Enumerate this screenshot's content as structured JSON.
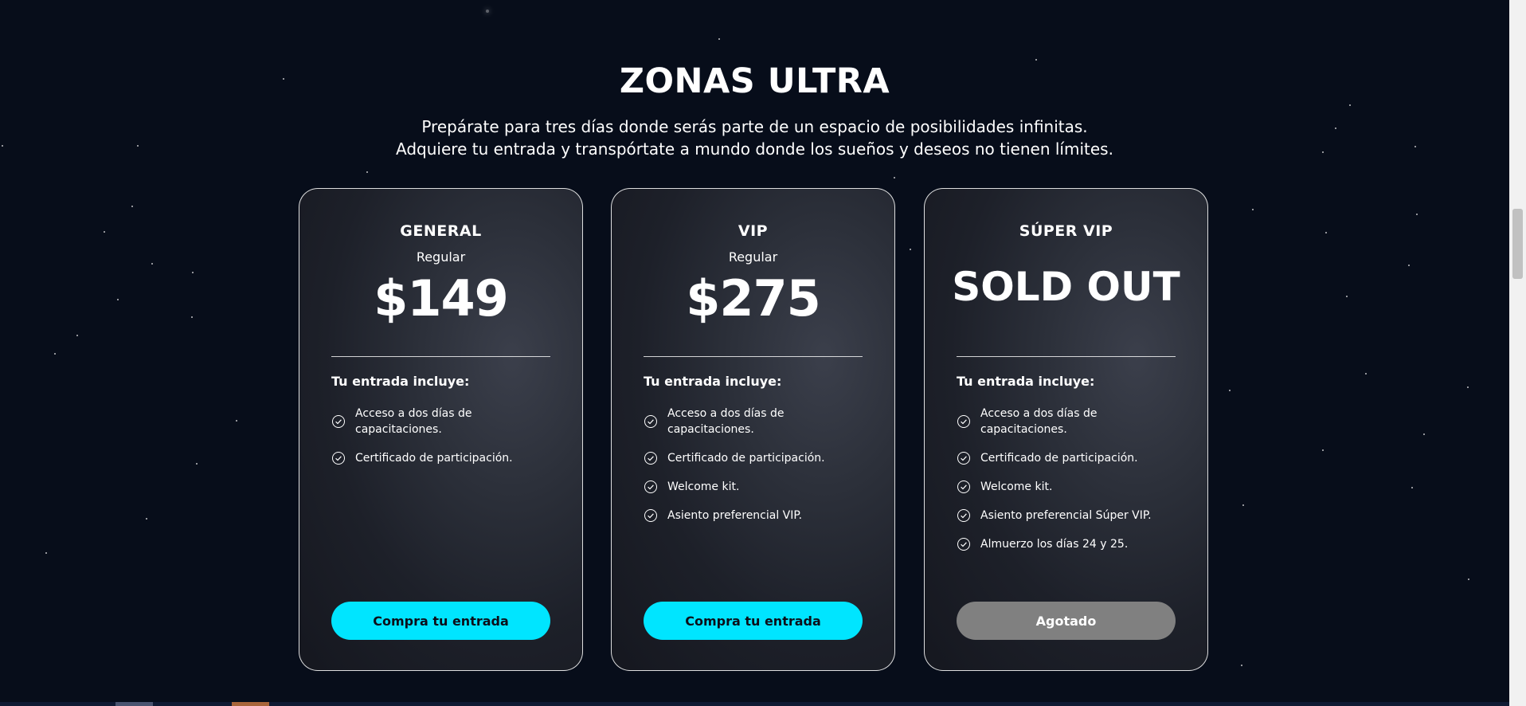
{
  "section": {
    "title": "ZONAS ULTRA",
    "subtitle_line1": "Prepárate para tres días donde serás parte de un espacio de posibilidades infinitas.",
    "subtitle_line2": "Adquiere tu entrada y transpórtate a mundo donde los sueños y deseos no tienen límites."
  },
  "colors": {
    "background": "#070d1a",
    "accent": "#00e5ff",
    "sold_out_button": "#808080"
  },
  "cards": [
    {
      "name": "GENERAL",
      "subtitle": "Regular",
      "price": "$149",
      "includes_label": "Tu entrada incluye:",
      "features": [
        "Acceso a dos días de capacitaciones.",
        "Certificado de participación."
      ],
      "button": "Compra tu entrada"
    },
    {
      "name": "VIP",
      "subtitle": "Regular",
      "price": "$275",
      "includes_label": "Tu entrada incluye:",
      "features": [
        "Acceso a dos días de capacitaciones.",
        "Certificado de participación.",
        "Welcome kit.",
        "Asiento preferencial VIP."
      ],
      "button": "Compra tu entrada"
    },
    {
      "name": "SÚPER VIP",
      "status": "SOLD OUT",
      "includes_label": "Tu entrada incluye:",
      "features": [
        "Acceso a dos días de capacitaciones.",
        "Certificado de participación.",
        "Welcome kit.",
        "Asiento preferencial Súper VIP.",
        "Almuerzo los días 24 y 25."
      ],
      "button": "Agotado"
    }
  ]
}
